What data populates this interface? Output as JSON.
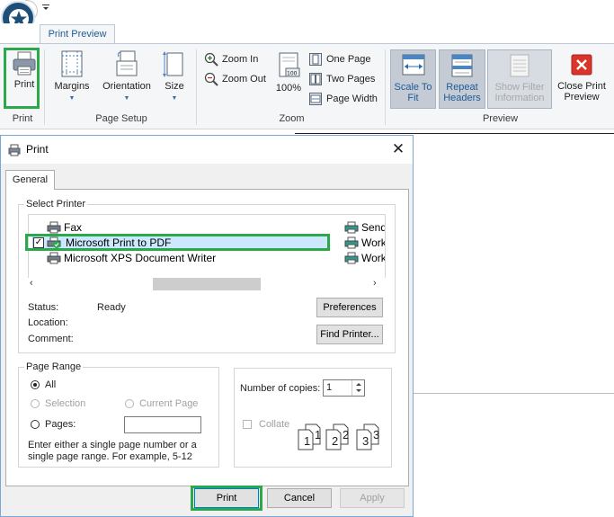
{
  "ribbon": {
    "tab_label": "Print Preview",
    "groups": {
      "print": "Print",
      "page_setup": "Page Setup",
      "zoom": "Zoom",
      "preview": "Preview"
    },
    "buttons": {
      "print": "Print",
      "margins": "Margins",
      "orientation": "Orientation",
      "size": "Size",
      "zoom_in": "Zoom In",
      "zoom_out": "Zoom Out",
      "zoom_100": "100%",
      "one_page": "One Page",
      "two_pages": "Two Pages",
      "page_width": "Page Width",
      "scale_to_fit_1": "Scale To",
      "scale_to_fit_2": "Fit",
      "repeat_headers_1": "Repeat",
      "repeat_headers_2": "Headers",
      "show_filter_1": "Show Filter",
      "show_filter_2": "Information",
      "close_preview_1": "Close Print",
      "close_preview_2": "Preview"
    },
    "icons": [
      "app-logo-icon",
      "qat-dropdown-icon",
      "printer-icon",
      "margins-icon",
      "orientation-icon",
      "size-icon",
      "zoom-in-icon",
      "zoom-out-icon",
      "zoom-100-icon",
      "one-page-icon",
      "two-pages-icon",
      "page-width-icon",
      "scale-to-fit-icon",
      "repeat-headers-icon",
      "show-filter-icon",
      "close-preview-icon"
    ]
  },
  "dialog": {
    "title": "Print",
    "close": "✕",
    "tab_general": "General",
    "select_printer_legend": "Select Printer",
    "printers": [
      {
        "name": "Fax",
        "checked": false,
        "selected": false
      },
      {
        "name": "Microsoft Print to PDF",
        "checked": true,
        "selected": true
      },
      {
        "name": "Microsoft XPS Document Writer",
        "checked": false,
        "selected": false
      }
    ],
    "printers_right": [
      "Send",
      "Work",
      "Work"
    ],
    "status_label": "Status:",
    "status_value": "Ready",
    "location_label": "Location:",
    "comment_label": "Comment:",
    "preferences_button": "Preferences",
    "find_printer_button": "Find Printer...",
    "page_range_legend": "Page Range",
    "range_all": "All",
    "range_selection": "Selection",
    "range_current": "Current Page",
    "range_pages": "Pages:",
    "range_hint": "Enter either a single page number or a single page range.  For example, 5-12",
    "copies_label": "Number of copies:",
    "copies_value": "1",
    "collate_label": "Collate",
    "collate_pages": [
      "1",
      "1",
      "2",
      "2",
      "3",
      "3"
    ],
    "print_button": "Print",
    "cancel_button": "Cancel",
    "apply_button": "Apply"
  },
  "colors": {
    "highlight": "#2aa84a",
    "accent": "#1e5b94",
    "selection": "#cce8ff"
  }
}
